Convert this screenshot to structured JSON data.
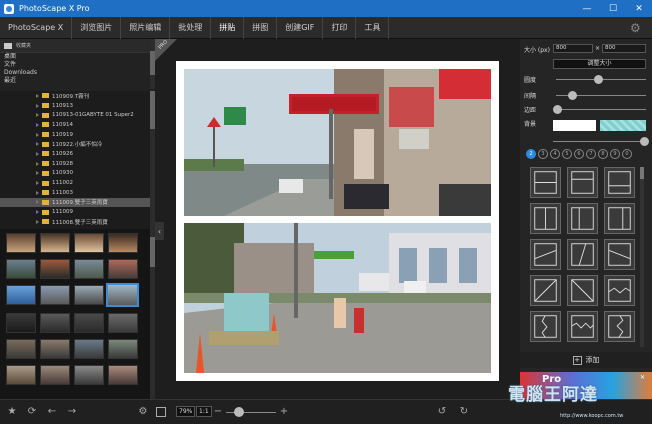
{
  "window": {
    "title": "PhotoScape X Pro",
    "minimize": "—",
    "maximize": "☐",
    "close": "✕"
  },
  "menu": {
    "items": [
      "PhotoScape X",
      "浏览图片",
      "照片编辑",
      "批处理",
      "拼贴",
      "拼图",
      "创建GIF",
      "打印",
      "工具"
    ],
    "active": "拼贴"
  },
  "sidebar": {
    "favorites_label": "收藏夹",
    "places": [
      "桌面",
      "文件",
      "Downloads",
      "最近"
    ],
    "folders": [
      "110909.T霧刊",
      "110913",
      "110913-01GABYTE 01 Super2",
      "110914",
      "110919",
      "110922.小編不怕冷",
      "110926",
      "110928",
      "110930",
      "111002",
      "111003",
      "111009.雙子三英雨寶",
      "111009",
      "111008.雙子三英雨寶"
    ],
    "selected_folder": "111009.雙子三英雨寶"
  },
  "canvas": {
    "pro_badge": "PRO"
  },
  "right_panel": {
    "size_label": "大小 (px)",
    "width_value": "800",
    "times": "×",
    "height_value": "800",
    "resize_button": "调整大小",
    "roundness_label": "圆度",
    "spacing_label": "间隔",
    "margin_label": "边距",
    "background_label": "背景",
    "layout_tabs": [
      "2",
      "3",
      "4",
      "5",
      "6",
      "7",
      "8",
      "9",
      "0"
    ],
    "active_layout_tab": "2",
    "add_button": "添加",
    "ad_text": "Pro"
  },
  "bottom": {
    "zoom_value": "79%",
    "zoom_fit": "1:1",
    "zoom_minus": "−",
    "zoom_plus": "+"
  },
  "watermark": {
    "text": "電腦王阿達",
    "url": "http://www.koopc.com.tw"
  },
  "colors": {
    "titlebar": "#1f6fc4",
    "accent": "#2d8ae0",
    "background_swatch_1": "#ffffff",
    "background_swatch_2": "#7fcfd0"
  }
}
